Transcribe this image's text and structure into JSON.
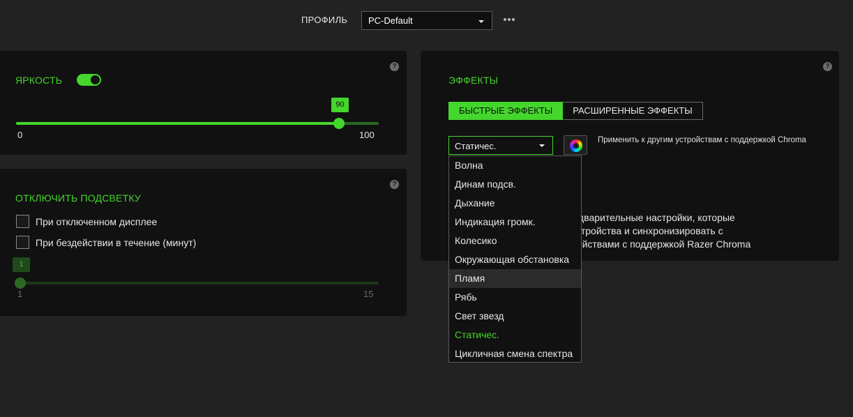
{
  "header": {
    "profile_label": "ПРОФИЛЬ",
    "profile_value": "PC-Default",
    "more_icon": "more-horizontal-icon"
  },
  "brightness": {
    "title": "ЯРКОСТЬ",
    "toggle_on": true,
    "value": "90",
    "min": "0",
    "max": "100",
    "help": "?"
  },
  "backlight": {
    "title": "ОТКЛЮЧИТЬ ПОДСВЕТКУ",
    "option_display_off": "При отключенном дисплее",
    "option_idle": "При бездействии в течение (минут)",
    "idle_value": "1",
    "idle_min": "1",
    "idle_max": "15",
    "help": "?"
  },
  "effects": {
    "title": "ЭФФЕКТЫ",
    "tab_quick": "БЫСТРЫЕ ЭФФЕКТЫ",
    "tab_advanced": "РАСШИРЕННЫЕ ЭФФЕКТЫ",
    "selected_effect": "Статичес.",
    "apply_text": "Применить к другим устройствам с поддержкой Chroma",
    "desc_line1": "дварительные настройки, которые",
    "desc_line2": "устройства и синхронизировать с",
    "desc_line3": "ройствами с поддержкой Razer Chroma",
    "help": "?",
    "dropdown_items": [
      "Волна",
      "Динам подсв.",
      "Дыхание",
      "Индикация громк.",
      "Колесико",
      "Окружающая обстановка",
      "Пламя",
      "Рябь",
      "Свет звезд",
      "Статичес.",
      "Цикличная смена спектра"
    ]
  },
  "colors": {
    "accent": "#44d62c",
    "accent_dim": "#2a6a22",
    "panel": "#111111",
    "background": "#222222"
  }
}
